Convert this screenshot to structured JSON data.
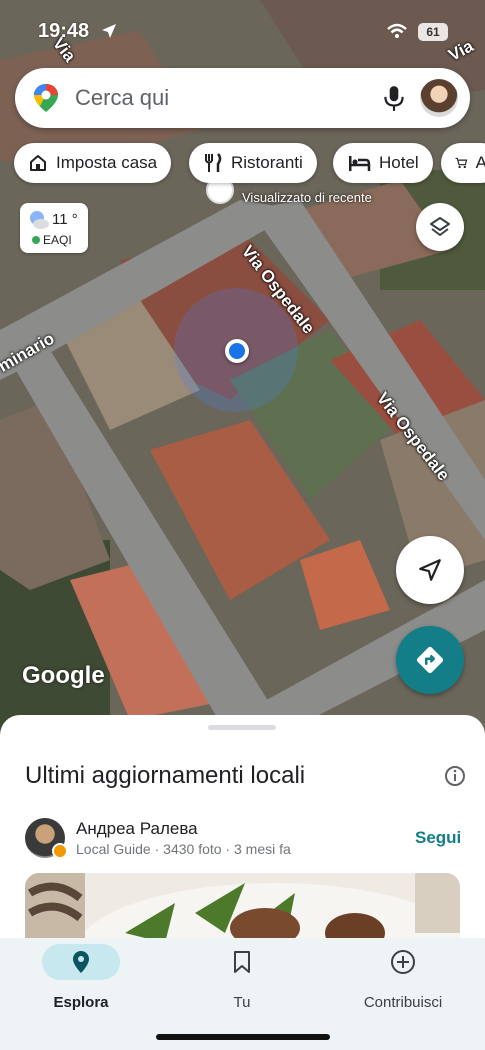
{
  "status_bar": {
    "time": "19:48",
    "battery": "61"
  },
  "search": {
    "placeholder": "Cerca qui"
  },
  "chips": [
    {
      "label": "Imposta casa",
      "icon": "home-icon"
    },
    {
      "label": "Ristoranti",
      "icon": "restaurant-icon"
    },
    {
      "label": "Hotel",
      "icon": "hotel-icon"
    },
    {
      "label": "A",
      "icon": "shopping-cart-icon"
    }
  ],
  "weather": {
    "temperature": "11 °",
    "aqi": "EAQI"
  },
  "map": {
    "roads": [
      "Via Ospedale",
      "Via Ospedale",
      "minario",
      "Via"
    ],
    "poi_subtitle": "Visualizzato di recente",
    "attribution": "Google",
    "accent": "#137e87",
    "location_dot_color": "#1a73e8"
  },
  "sheet": {
    "title": "Ultimi aggiornamenti locali",
    "user": {
      "name": "Андреа Ралева",
      "meta": "Local Guide · 3430 foto · 3 mesi fa"
    },
    "follow_label": "Segui"
  },
  "nav": [
    {
      "label": "Esplora",
      "icon": "location-pin-icon",
      "active": true
    },
    {
      "label": "Tu",
      "icon": "bookmark-icon",
      "active": false
    },
    {
      "label": "Contribuisci",
      "icon": "add-circle-icon",
      "active": false
    }
  ]
}
